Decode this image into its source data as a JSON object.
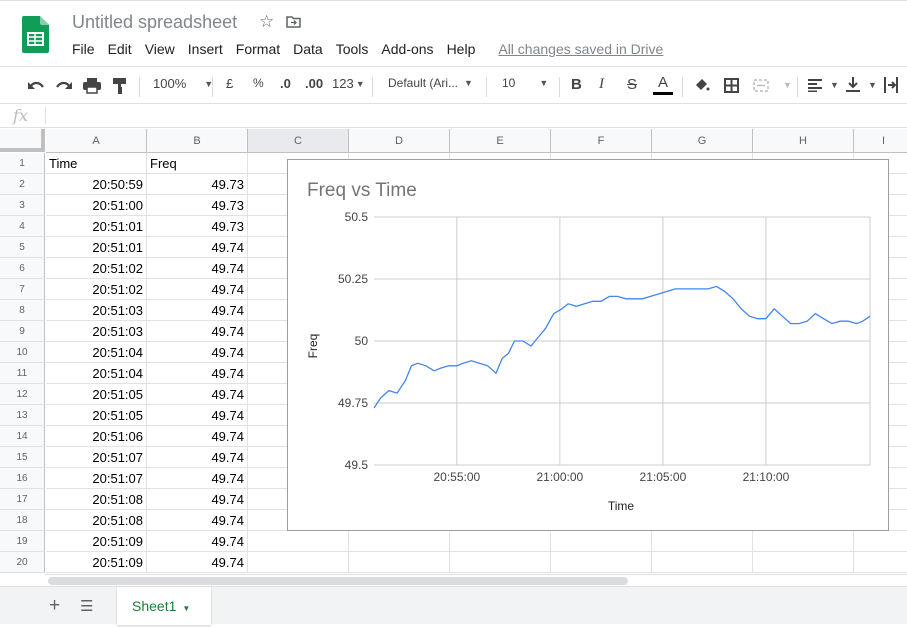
{
  "app": {
    "title": "Untitled spreadsheet",
    "save_status": "All changes saved in Drive",
    "brand_color": "#0f9d58"
  },
  "menu": [
    "File",
    "Edit",
    "View",
    "Insert",
    "Format",
    "Data",
    "Tools",
    "Add-ons",
    "Help"
  ],
  "toolbar": {
    "zoom": "100%",
    "currency": "£",
    "percent": "%",
    "decrease_decimal": ".0",
    "increase_decimal": ".00",
    "more_formats": "123",
    "font": "Default (Ari...",
    "font_size": "10",
    "bold": "B",
    "italic": "I",
    "strike": "S",
    "text_color": "A"
  },
  "formula_bar": {
    "fx": "fx",
    "value": ""
  },
  "columns": [
    "A",
    "B",
    "C",
    "D",
    "E",
    "F",
    "G",
    "H",
    "I"
  ],
  "rows": [
    {
      "n": "1",
      "a": "Time",
      "b": "Freq",
      "header": true
    },
    {
      "n": "2",
      "a": "20:50:59",
      "b": "49.73"
    },
    {
      "n": "3",
      "a": "20:51:00",
      "b": "49.73"
    },
    {
      "n": "4",
      "a": "20:51:01",
      "b": "49.73"
    },
    {
      "n": "5",
      "a": "20:51:01",
      "b": "49.74"
    },
    {
      "n": "6",
      "a": "20:51:02",
      "b": "49.74"
    },
    {
      "n": "7",
      "a": "20:51:02",
      "b": "49.74"
    },
    {
      "n": "8",
      "a": "20:51:03",
      "b": "49.74"
    },
    {
      "n": "9",
      "a": "20:51:03",
      "b": "49.74"
    },
    {
      "n": "10",
      "a": "20:51:04",
      "b": "49.74"
    },
    {
      "n": "11",
      "a": "20:51:04",
      "b": "49.74"
    },
    {
      "n": "12",
      "a": "20:51:05",
      "b": "49.74"
    },
    {
      "n": "13",
      "a": "20:51:05",
      "b": "49.74"
    },
    {
      "n": "14",
      "a": "20:51:06",
      "b": "49.74"
    },
    {
      "n": "15",
      "a": "20:51:07",
      "b": "49.74"
    },
    {
      "n": "16",
      "a": "20:51:07",
      "b": "49.74"
    },
    {
      "n": "17",
      "a": "20:51:08",
      "b": "49.74"
    },
    {
      "n": "18",
      "a": "20:51:08",
      "b": "49.74"
    },
    {
      "n": "19",
      "a": "20:51:09",
      "b": "49.74"
    },
    {
      "n": "20",
      "a": "20:51:09",
      "b": "49.74"
    }
  ],
  "sheets": {
    "active": "Sheet1"
  },
  "chart_data": {
    "type": "line",
    "title": "Freq vs Time",
    "xlabel": "Time",
    "ylabel": "Freq",
    "ylim": [
      49.5,
      50.5
    ],
    "yticks": [
      "49.5",
      "49.75",
      "50",
      "50.25",
      "50.5"
    ],
    "ytick_values": [
      49.5,
      49.75,
      50,
      50.25,
      50.5
    ],
    "xlim_minutes_after_2050": [
      0.98,
      25.05
    ],
    "xticks": [
      "20:55:00",
      "21:00:00",
      "21:05:00",
      "21:10:00"
    ],
    "xtick_minutes_after_2050": [
      5,
      10,
      15,
      20
    ],
    "grid": true,
    "legend": "none",
    "line_color": "#4285f4",
    "series": [
      {
        "name": "Freq",
        "x_minutes_after_2050": [
          0.98,
          1.3,
          1.7,
          2.1,
          2.5,
          2.8,
          3.1,
          3.5,
          3.9,
          4.2,
          4.6,
          5.0,
          5.3,
          5.7,
          6.1,
          6.5,
          6.9,
          7.2,
          7.5,
          7.8,
          8.2,
          8.6,
          9.0,
          9.3,
          9.7,
          10.1,
          10.4,
          10.8,
          11.2,
          11.6,
          12.0,
          12.4,
          12.8,
          13.2,
          13.6,
          14.0,
          14.4,
          14.8,
          15.2,
          15.6,
          16.0,
          16.4,
          16.8,
          17.2,
          17.6,
          18.0,
          18.4,
          18.8,
          19.2,
          19.6,
          20.0,
          20.4,
          20.8,
          21.2,
          21.6,
          22.0,
          22.4,
          22.8,
          23.2,
          23.6,
          24.0,
          24.4,
          24.7,
          25.05
        ],
        "y": [
          49.73,
          49.77,
          49.8,
          49.79,
          49.84,
          49.9,
          49.91,
          49.9,
          49.88,
          49.89,
          49.9,
          49.9,
          49.91,
          49.92,
          49.91,
          49.9,
          49.87,
          49.93,
          49.95,
          50.0,
          50.0,
          49.98,
          50.02,
          50.05,
          50.11,
          50.13,
          50.15,
          50.14,
          50.15,
          50.16,
          50.16,
          50.18,
          50.18,
          50.17,
          50.17,
          50.17,
          50.18,
          50.19,
          50.2,
          50.21,
          50.21,
          50.21,
          50.21,
          50.21,
          50.22,
          50.2,
          50.17,
          50.13,
          50.1,
          50.09,
          50.09,
          50.13,
          50.1,
          50.07,
          50.07,
          50.08,
          50.11,
          50.09,
          50.07,
          50.08,
          50.08,
          50.07,
          50.08,
          50.1
        ]
      }
    ]
  }
}
